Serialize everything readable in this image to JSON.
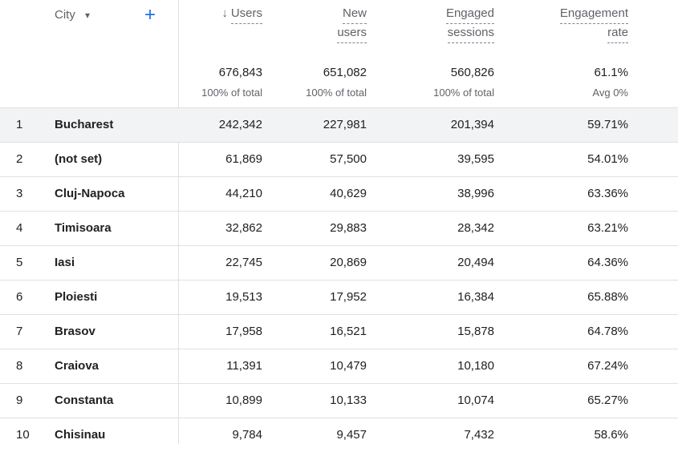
{
  "header": {
    "city_label": "City",
    "caret": "▾",
    "add": "+",
    "sort_arrow": "↓",
    "users_label": "Users",
    "new_users_1": "New",
    "new_users_2": "users",
    "engaged_1": "Engaged",
    "engaged_2": "sessions",
    "eng_rate_1": "Engagement",
    "eng_rate_2": "rate"
  },
  "totals": {
    "users": "676,843",
    "users_sub": "100% of total",
    "new_users": "651,082",
    "new_users_sub": "100% of total",
    "engaged": "560,826",
    "engaged_sub": "100% of total",
    "rate": "61.1%",
    "rate_sub": "Avg 0%"
  },
  "rows": [
    {
      "idx": "1",
      "city": "Bucharest",
      "users": "242,342",
      "new_users": "227,981",
      "engaged": "201,394",
      "rate": "59.71%"
    },
    {
      "idx": "2",
      "city": "(not set)",
      "users": "61,869",
      "new_users": "57,500",
      "engaged": "39,595",
      "rate": "54.01%"
    },
    {
      "idx": "3",
      "city": "Cluj-Napoca",
      "users": "44,210",
      "new_users": "40,629",
      "engaged": "38,996",
      "rate": "63.36%"
    },
    {
      "idx": "4",
      "city": "Timisoara",
      "users": "32,862",
      "new_users": "29,883",
      "engaged": "28,342",
      "rate": "63.21%"
    },
    {
      "idx": "5",
      "city": "Iasi",
      "users": "22,745",
      "new_users": "20,869",
      "engaged": "20,494",
      "rate": "64.36%"
    },
    {
      "idx": "6",
      "city": "Ploiesti",
      "users": "19,513",
      "new_users": "17,952",
      "engaged": "16,384",
      "rate": "65.88%"
    },
    {
      "idx": "7",
      "city": "Brasov",
      "users": "17,958",
      "new_users": "16,521",
      "engaged": "15,878",
      "rate": "64.78%"
    },
    {
      "idx": "8",
      "city": "Craiova",
      "users": "11,391",
      "new_users": "10,479",
      "engaged": "10,180",
      "rate": "67.24%"
    },
    {
      "idx": "9",
      "city": "Constanta",
      "users": "10,899",
      "new_users": "10,133",
      "engaged": "10,074",
      "rate": "65.27%"
    },
    {
      "idx": "10",
      "city": "Chisinau",
      "users": "9,784",
      "new_users": "9,457",
      "engaged": "7,432",
      "rate": "58.6%"
    }
  ]
}
